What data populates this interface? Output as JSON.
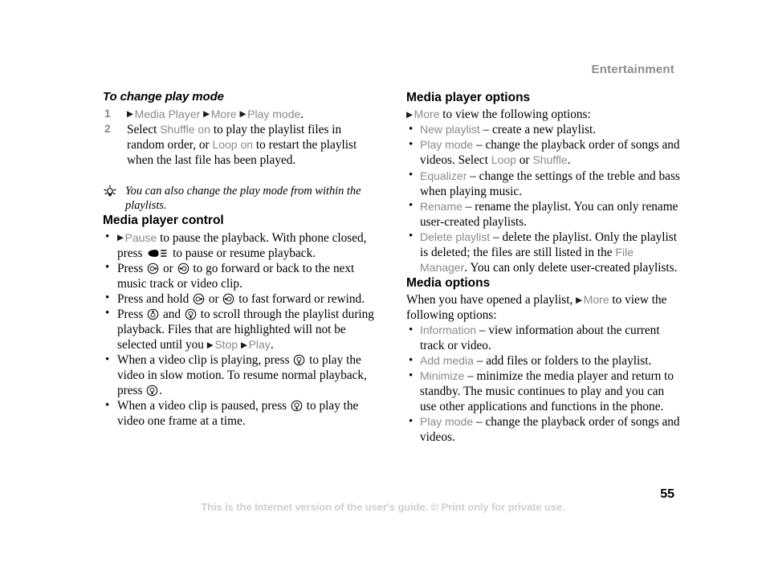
{
  "header": {
    "chapter": "Entertainment"
  },
  "left_column": {
    "task_heading": "To change play mode",
    "steps": [
      {
        "num": "1",
        "parts": [
          {
            "t": "arrow"
          },
          {
            "t": "ui",
            "v": "Media Player "
          },
          {
            "t": "arrow"
          },
          {
            "t": "ui",
            "v": "More "
          },
          {
            "t": "arrow"
          },
          {
            "t": "ui",
            "v": "Play mode"
          },
          {
            "t": "text",
            "v": "."
          }
        ]
      },
      {
        "num": "2",
        "parts": [
          {
            "t": "text",
            "v": "Select "
          },
          {
            "t": "ui",
            "v": "Shuffle on"
          },
          {
            "t": "text",
            "v": " to play the playlist files in random order, or "
          },
          {
            "t": "ui",
            "v": "Loop on"
          },
          {
            "t": "text",
            "v": " to restart the playlist when the last file has been played."
          }
        ]
      }
    ],
    "tip": {
      "icon": "lightbulb-icon",
      "text": "You can also change the play mode from within the playlists."
    },
    "control_heading": "Media player control",
    "control_bullets": [
      {
        "parts": [
          {
            "t": "arrow"
          },
          {
            "t": "ui",
            "v": "Pause"
          },
          {
            "t": "text",
            "v": " to pause the playback. With phone closed, press "
          },
          {
            "t": "key",
            "v": "menu-key-icon"
          },
          {
            "t": "text",
            "v": " to pause or resume playback."
          }
        ]
      },
      {
        "parts": [
          {
            "t": "text",
            "v": "Press "
          },
          {
            "t": "key",
            "v": "nav-right-key-icon"
          },
          {
            "t": "text",
            "v": " or "
          },
          {
            "t": "key",
            "v": "nav-left-key-icon"
          },
          {
            "t": "text",
            "v": " to go forward or back to the next music track or video clip."
          }
        ]
      },
      {
        "parts": [
          {
            "t": "text",
            "v": "Press and hold "
          },
          {
            "t": "key",
            "v": "nav-right-key-icon"
          },
          {
            "t": "text",
            "v": " or "
          },
          {
            "t": "key",
            "v": "nav-left-key-icon"
          },
          {
            "t": "text",
            "v": " to fast forward or rewind."
          }
        ]
      },
      {
        "parts": [
          {
            "t": "text",
            "v": "Press "
          },
          {
            "t": "key",
            "v": "nav-up-key-icon"
          },
          {
            "t": "text",
            "v": " and "
          },
          {
            "t": "key",
            "v": "nav-down-key-icon"
          },
          {
            "t": "text",
            "v": " to scroll through the playlist during playback. Files that are highlighted will not be selected until you "
          },
          {
            "t": "arrow"
          },
          {
            "t": "ui",
            "v": "Stop "
          },
          {
            "t": "arrow"
          },
          {
            "t": "ui",
            "v": "Play"
          },
          {
            "t": "text",
            "v": "."
          }
        ]
      },
      {
        "parts": [
          {
            "t": "text",
            "v": "When a video clip is playing, press "
          },
          {
            "t": "key",
            "v": "nav-down-key-icon"
          },
          {
            "t": "text",
            "v": " to play the video in slow motion. To resume normal playback, press "
          },
          {
            "t": "key",
            "v": "nav-down-key-icon"
          },
          {
            "t": "text",
            "v": "."
          }
        ]
      },
      {
        "parts": [
          {
            "t": "text",
            "v": "When a video clip is paused, press "
          },
          {
            "t": "key",
            "v": "nav-down-key-icon"
          },
          {
            "t": "text",
            "v": " to play the video one frame at a time."
          }
        ]
      }
    ]
  },
  "right_column": {
    "player_options_heading": "Media player options",
    "player_options_lead": {
      "parts": [
        {
          "t": "arrow"
        },
        {
          "t": "ui",
          "v": "More"
        },
        {
          "t": "text",
          "v": " to view the following options:"
        }
      ]
    },
    "player_options_bullets": [
      {
        "parts": [
          {
            "t": "ui",
            "v": "New playlist"
          },
          {
            "t": "text",
            "v": " – create a new playlist."
          }
        ]
      },
      {
        "parts": [
          {
            "t": "ui",
            "v": "Play mode"
          },
          {
            "t": "text",
            "v": " – change the playback order of songs and videos. Select "
          },
          {
            "t": "ui",
            "v": "Loop"
          },
          {
            "t": "text",
            "v": " or "
          },
          {
            "t": "ui",
            "v": "Shuffle"
          },
          {
            "t": "text",
            "v": "."
          }
        ]
      },
      {
        "parts": [
          {
            "t": "ui",
            "v": "Equalizer"
          },
          {
            "t": "text",
            "v": " – change the settings of the treble and bass when playing music."
          }
        ]
      },
      {
        "parts": [
          {
            "t": "ui",
            "v": "Rename"
          },
          {
            "t": "text",
            "v": " – rename the playlist. You can only rename user-created playlists."
          }
        ]
      },
      {
        "parts": [
          {
            "t": "ui",
            "v": "Delete playlist"
          },
          {
            "t": "text",
            "v": " – delete the playlist. Only the playlist is deleted; the files are still listed in the "
          },
          {
            "t": "ui",
            "v": "File Manager"
          },
          {
            "t": "text",
            "v": ". You can only delete user-created playlists."
          }
        ]
      }
    ],
    "media_options_heading": "Media options",
    "media_options_lead": {
      "parts": [
        {
          "t": "text",
          "v": "When you have opened a playlist, "
        },
        {
          "t": "arrow"
        },
        {
          "t": "ui",
          "v": "More"
        },
        {
          "t": "text",
          "v": " to view the following options:"
        }
      ]
    },
    "media_options_bullets": [
      {
        "parts": [
          {
            "t": "ui",
            "v": "Information"
          },
          {
            "t": "text",
            "v": " – view information about the current track or video."
          }
        ]
      },
      {
        "parts": [
          {
            "t": "ui",
            "v": "Add media"
          },
          {
            "t": "text",
            "v": " – add files or folders to the playlist."
          }
        ]
      },
      {
        "parts": [
          {
            "t": "ui",
            "v": "Minimize"
          },
          {
            "t": "text",
            "v": " – minimize the media player and return to standby. The music continues to play and you can use other applications and functions in the phone."
          }
        ]
      },
      {
        "parts": [
          {
            "t": "ui",
            "v": "Play mode"
          },
          {
            "t": "text",
            "v": " – change the playback order of songs and videos."
          }
        ]
      }
    ]
  },
  "footer": {
    "note": "This is the Internet version of the user's guide. © Print only for private use.",
    "page_number": "55"
  },
  "colors": {
    "ui_term_gray": "#8a8a8a",
    "header_gray": "#8c8c8c",
    "footer_gray": "#cfcfcf",
    "body_black": "#000000"
  }
}
